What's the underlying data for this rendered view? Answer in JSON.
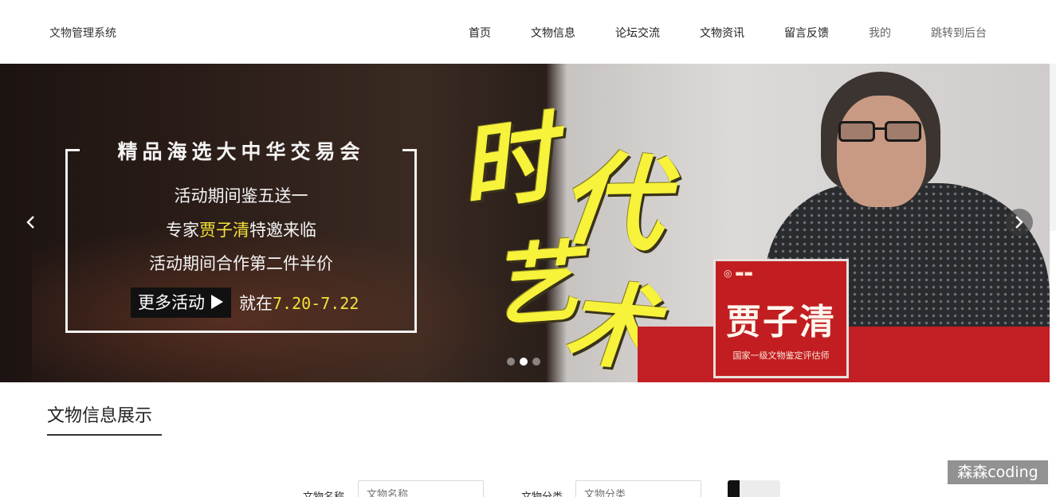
{
  "header": {
    "brand": "文物管理系统",
    "nav": [
      {
        "label": "首页"
      },
      {
        "label": "文物信息"
      },
      {
        "label": "论坛交流"
      },
      {
        "label": "文物资讯"
      },
      {
        "label": "留言反馈"
      },
      {
        "label": "我的"
      },
      {
        "label": "跳转到后台"
      }
    ]
  },
  "banner": {
    "title": "精品海选大中华交易会",
    "line1": "活动期间鉴五送一",
    "line2_pre": "专家",
    "line2_name": "贾子清",
    "line2_post": "特邀来临",
    "line3": "活动期间合作第二件半价",
    "more_label": "更多活动",
    "date_pre": "就在",
    "date_range": "7.20-7.22",
    "calligraphy": [
      "时",
      "代",
      "艺",
      "术"
    ],
    "placard_name": "贾子清",
    "placard_title": "国家一级文物鉴定评估师",
    "slide_count": 3,
    "active_slide": 2,
    "colors": {
      "highlight": "#f3e23a",
      "placard": "#c21e22"
    }
  },
  "section": {
    "title": "文物信息展示"
  },
  "search": {
    "label1": "文物名称",
    "placeholder1": "文物名称",
    "label2": "文物分类",
    "placeholder2": "文物分类"
  },
  "watermark": "森森coding"
}
